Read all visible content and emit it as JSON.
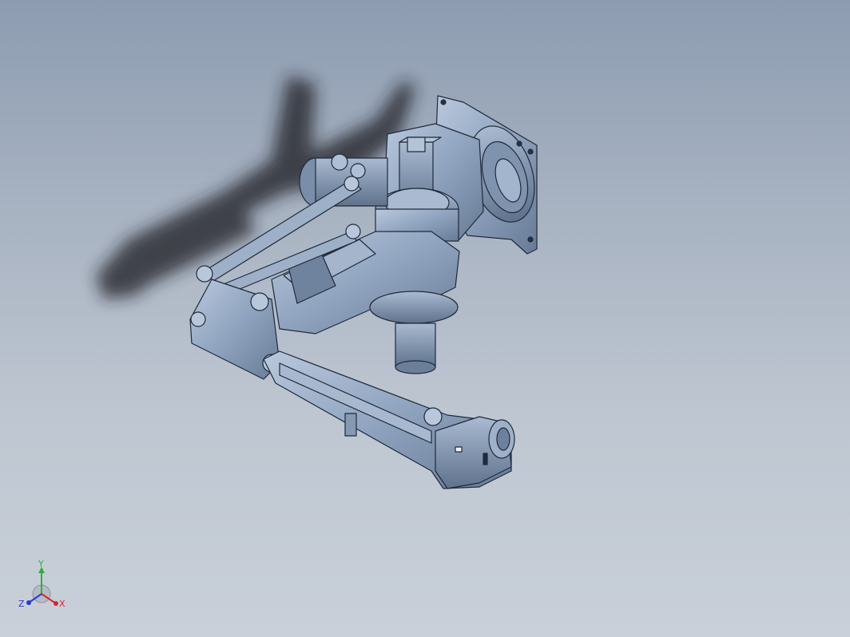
{
  "viewport": {
    "model": "robot-arm-assembly",
    "colors": {
      "background_top": "#8d9cb1",
      "background_bottom": "#c9d0d9",
      "part_fill": "#8fa3bf",
      "part_light": "#aebfd6",
      "part_dark": "#5b6d86",
      "edge": "#1f2a3a",
      "shadow": "#1a1d24"
    }
  },
  "triad": {
    "x_label": "X",
    "y_label": "Y",
    "z_label": "Z",
    "x_color": "#d8262b",
    "y_color": "#2fae3a",
    "z_color": "#2a3ad0"
  }
}
